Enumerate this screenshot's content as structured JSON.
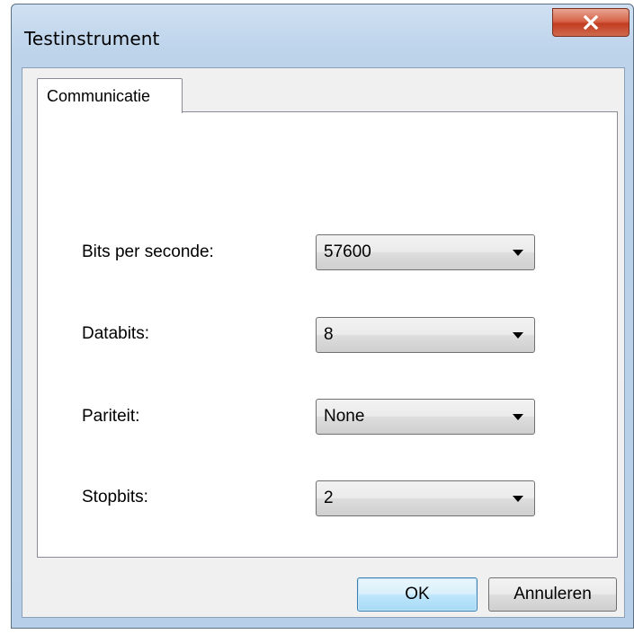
{
  "window": {
    "title": "Testinstrument",
    "close_icon": "close-icon"
  },
  "tabs": [
    {
      "label": "Communicatie",
      "selected": true
    }
  ],
  "fields": [
    {
      "label": "Bits per seconde:",
      "value": "57600"
    },
    {
      "label": "Databits:",
      "value": "8"
    },
    {
      "label": "Pariteit:",
      "value": "None"
    },
    {
      "label": "Stopbits:",
      "value": "2"
    }
  ],
  "buttons": {
    "ok": "OK",
    "cancel": "Annuleren"
  },
  "colors": {
    "title_bar": "#bcd3ea",
    "close_button": "#c23d22",
    "default_button": "#bee6fd"
  }
}
